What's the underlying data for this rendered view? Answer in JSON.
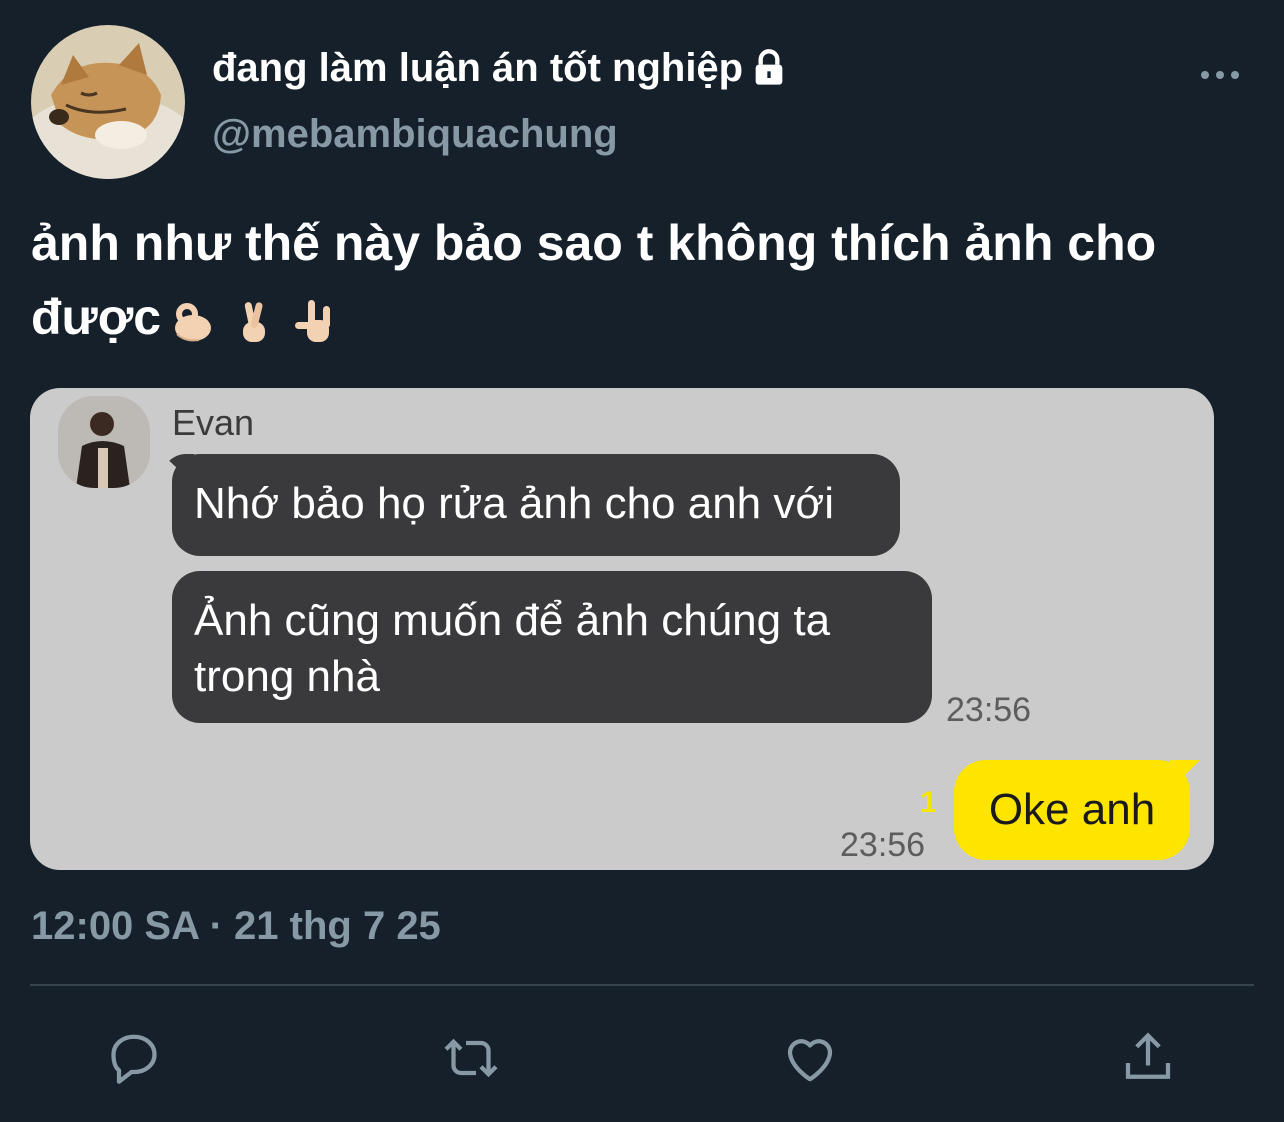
{
  "user": {
    "display_name": "đang làm luận án tốt nghiệp",
    "handle": "@mebambiquachung",
    "avatar_icon": "dog-avatar-icon",
    "protected_icon": "lock-icon"
  },
  "tweet": {
    "text": "ảnh như thế này bảo sao t không thích ảnh cho được",
    "emojis": [
      "👌🏻",
      "🤞🏻",
      "🤟🏻"
    ],
    "timestamp": "12:00 SA · 21 thg 7 25"
  },
  "chat": {
    "sender": "Evan",
    "messages": [
      {
        "text": "Nhớ bảo họ rửa ảnh cho anh với"
      },
      {
        "text": "Ảnh cũng muốn để ảnh chúng ta trong nhà",
        "time": "23:56"
      }
    ],
    "reply": {
      "text": "Oke anh",
      "time": "23:56",
      "unread": "1"
    }
  },
  "actions": [
    "reply-icon",
    "retweet-icon",
    "like-icon",
    "share-icon"
  ],
  "colors": {
    "background": "#15202b",
    "muted": "#8899a6",
    "kakao_yellow": "#fee500",
    "chat_bg": "#cbcbcb",
    "bubble_dark": "#3a3a3c"
  }
}
